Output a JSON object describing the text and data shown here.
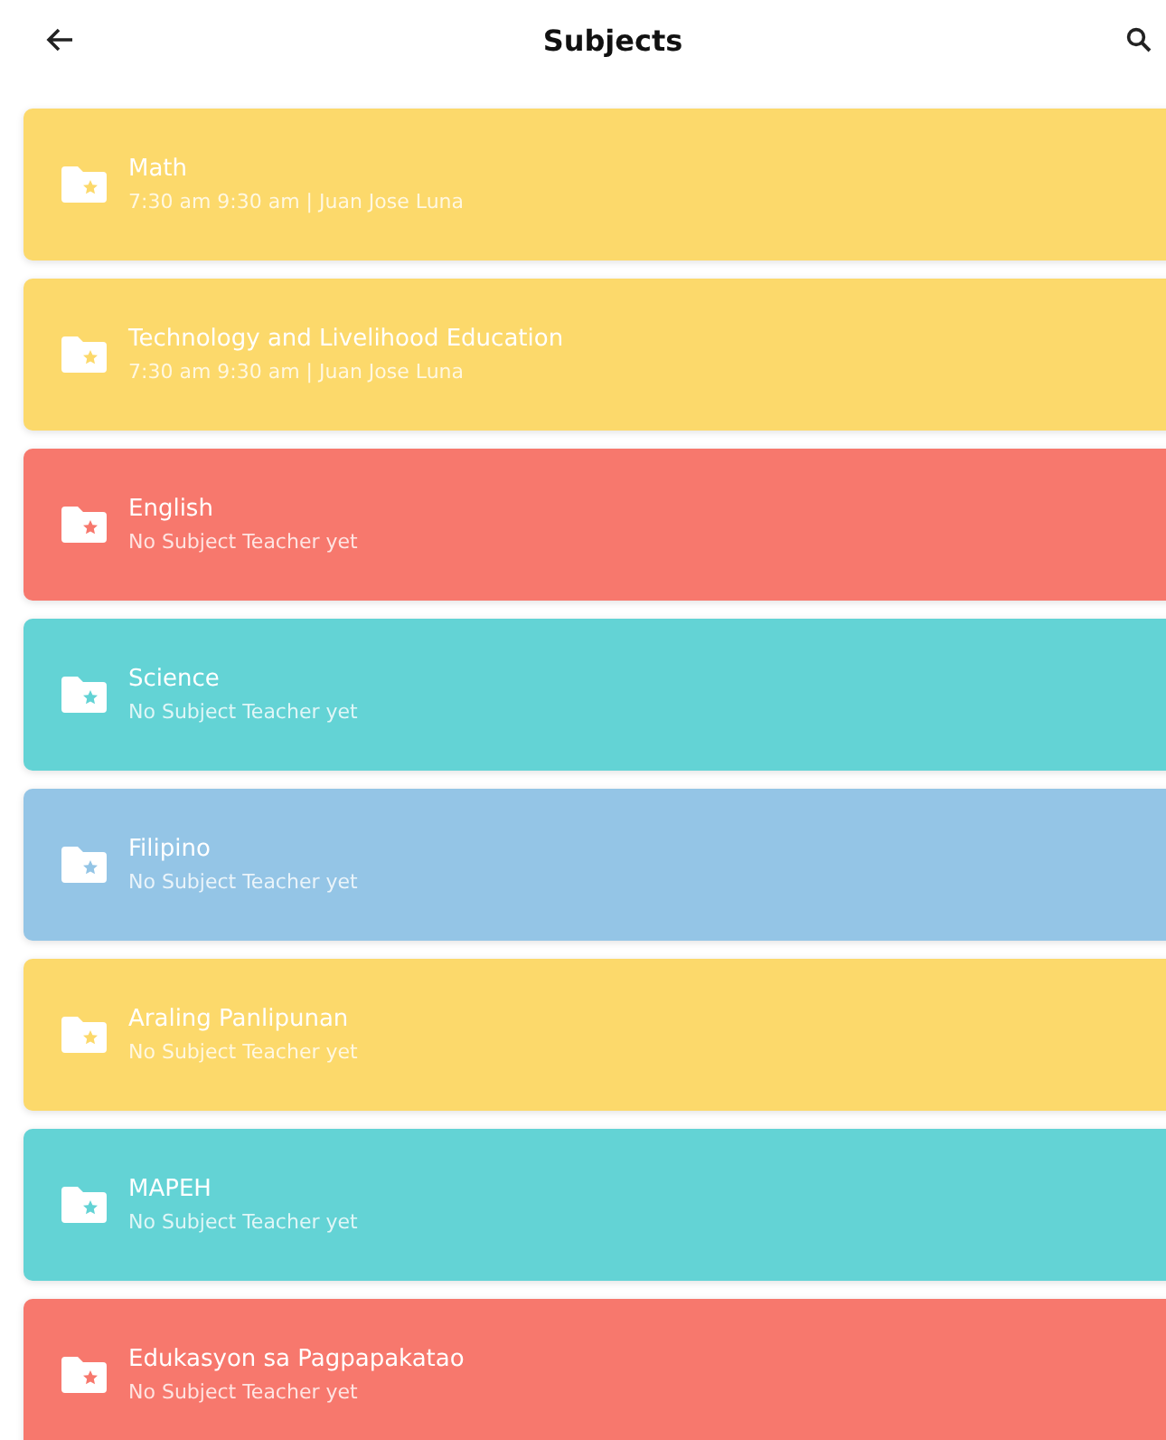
{
  "header": {
    "title": "Subjects"
  },
  "subjects": [
    {
      "name": "Math",
      "detail": "7:30 am 9:30 am | Juan Jose Luna",
      "color": "#fcd96b"
    },
    {
      "name": "Technology and Livelihood Education",
      "detail": "7:30 am 9:30 am | Juan Jose Luna",
      "color": "#fcd96b"
    },
    {
      "name": "English",
      "detail": "No Subject Teacher yet",
      "color": "#f7786d"
    },
    {
      "name": "Science",
      "detail": "No Subject Teacher yet",
      "color": "#63d3d5"
    },
    {
      "name": "Filipino",
      "detail": "No Subject Teacher yet",
      "color": "#94c5e6"
    },
    {
      "name": "Araling Panlipunan",
      "detail": "No Subject Teacher yet",
      "color": "#fcd96b"
    },
    {
      "name": "MAPEH",
      "detail": "No Subject Teacher yet",
      "color": "#63d3d5"
    },
    {
      "name": "Edukasyon sa Pagpapakatao",
      "detail": "No Subject Teacher yet",
      "color": "#f7786d"
    }
  ]
}
